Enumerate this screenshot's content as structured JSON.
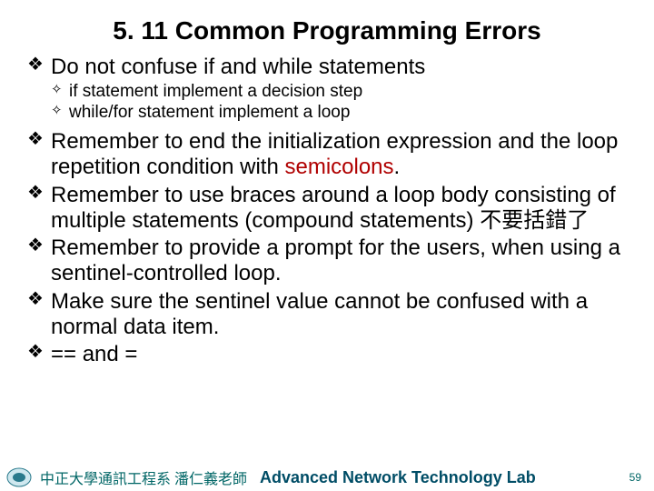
{
  "title": "5. 11 Common Programming Errors",
  "bullets": [
    {
      "text": "Do not confuse if and while statements",
      "sub": [
        "if statement implement a decision step",
        "while/for statement implement a loop"
      ]
    },
    {
      "pre": "Remember to end the initialization expression and the loop repetition condition with ",
      "hl": "semicolons",
      "post": "."
    },
    {
      "text": "Remember to use braces around a loop body consisting of multiple statements (compound statements) 不要括錯了"
    },
    {
      "text": "Remember to provide a prompt for the users, when using a sentinel-controlled loop."
    },
    {
      "text": "Make sure the sentinel value cannot be confused with a normal data item."
    },
    {
      "text": "== and ="
    }
  ],
  "footer": {
    "left": "中正大學通訊工程系 潘仁義老師",
    "center": "Advanced Network Technology Lab",
    "page": "59"
  }
}
